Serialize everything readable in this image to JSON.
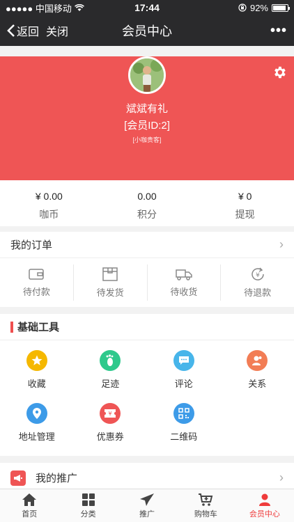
{
  "status_bar": {
    "carrier": "●●●●● 中国移动",
    "time": "17:44",
    "battery": "92%",
    "battery_level": 0.92
  },
  "nav": {
    "back_label": "返回",
    "close_label": "关闭",
    "title": "会员中心",
    "more_label": "•••"
  },
  "profile": {
    "nickname": "斌斌有礼",
    "member_id": "[会员ID:2]",
    "level": "[小咖贵客]"
  },
  "stats": [
    {
      "value": "¥ 0.00",
      "label": "咖币"
    },
    {
      "value": "0.00",
      "label": "积分"
    },
    {
      "value": "¥ 0",
      "label": "提现"
    }
  ],
  "orders": {
    "title": "我的订单",
    "tabs": [
      {
        "label": "待付款",
        "icon": "wallet-icon"
      },
      {
        "label": "待发货",
        "icon": "package-icon"
      },
      {
        "label": "待收货",
        "icon": "truck-icon"
      },
      {
        "label": "待退款",
        "icon": "refund-icon"
      }
    ]
  },
  "tools": {
    "title": "基础工具",
    "items": [
      {
        "label": "收藏",
        "icon": "star-icon",
        "color": "#f5b800"
      },
      {
        "label": "足迹",
        "icon": "footprint-icon",
        "color": "#2ec98c"
      },
      {
        "label": "评论",
        "icon": "comment-icon",
        "color": "#47b5ea"
      },
      {
        "label": "关系",
        "icon": "relation-icon",
        "color": "#f27d55"
      },
      {
        "label": "地址管理",
        "icon": "location-icon",
        "color": "#3d9be8"
      },
      {
        "label": "优惠券",
        "icon": "coupon-icon",
        "color": "#ef5555"
      },
      {
        "label": "二维码",
        "icon": "qrcode-icon",
        "color": "#3d9be8"
      }
    ]
  },
  "promo": {
    "label": "我的推广"
  },
  "tabbar": [
    {
      "label": "首页",
      "icon": "home-icon"
    },
    {
      "label": "分类",
      "icon": "grid-icon"
    },
    {
      "label": "推广",
      "icon": "paper-plane-icon"
    },
    {
      "label": "购物车",
      "icon": "cart-icon"
    },
    {
      "label": "会员中心",
      "icon": "user-icon",
      "active": true
    }
  ],
  "colors": {
    "header_bg": "#2a2a2c",
    "profile_bg": "#ef5555",
    "accent": "#ef3b3b"
  }
}
